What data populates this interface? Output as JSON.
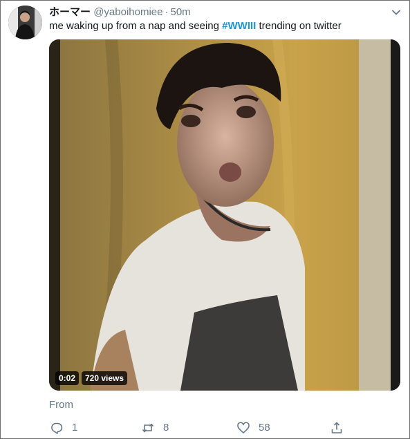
{
  "tweet": {
    "display_name": "ホーマー",
    "handle": "@yaboihomiee",
    "separator": "·",
    "time": "50m",
    "text_before": "me waking up from a nap and seeing ",
    "hashtag": "#WWIII",
    "text_after": " trending on twitter",
    "from_label": "From"
  },
  "video": {
    "duration": "0:02",
    "views": "720 views"
  },
  "actions": {
    "replies": "1",
    "retweets": "8",
    "likes": "58"
  },
  "colors": {
    "link": "#1b95e0",
    "secondary_text": "#657786",
    "primary_text": "#14171a"
  },
  "icons": [
    "chevron-down-icon",
    "reply-icon",
    "retweet-icon",
    "like-icon",
    "share-icon"
  ]
}
